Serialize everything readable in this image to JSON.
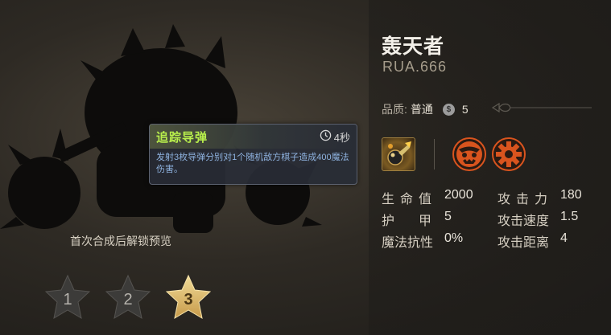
{
  "hero": {
    "name": "轰天者",
    "id": "RUA.666",
    "quality_label": "品质:",
    "quality_value": "普通",
    "coin_symbol": "$",
    "cost": "5"
  },
  "skill": {
    "name": "追踪导弹",
    "cooldown": "4秒",
    "description": "发射3枚导弹分别对1个随机敌方棋子造成400魔法伤害。",
    "icon": "missile-icon"
  },
  "traits": [
    {
      "icon": "demon-face-trait-icon",
      "color": "#d9541e"
    },
    {
      "icon": "gear-trait-icon",
      "color": "#d9541e"
    }
  ],
  "unlock_hint": "首次合成后解锁预览",
  "stars": [
    {
      "label": "1",
      "state": "locked"
    },
    {
      "label": "2",
      "state": "locked"
    },
    {
      "label": "3",
      "state": "active"
    }
  ],
  "stats": {
    "hp_label": "生命值",
    "hp_value": "2000",
    "attack_label": "攻击力",
    "attack_value": "180",
    "armor_label": "护甲",
    "armor_value": "5",
    "attack_speed_label": "攻击速度",
    "attack_speed_value": "1.5",
    "magic_resist_label": "魔法抗性",
    "magic_resist_value": "0%",
    "attack_range_label": "攻击距离",
    "attack_range_value": "4"
  },
  "colors": {
    "skill_name": "#b8ef4c",
    "skill_desc": "#8fb3e0",
    "star_active": "#d9b86a",
    "star_locked": "#3c3b39"
  }
}
